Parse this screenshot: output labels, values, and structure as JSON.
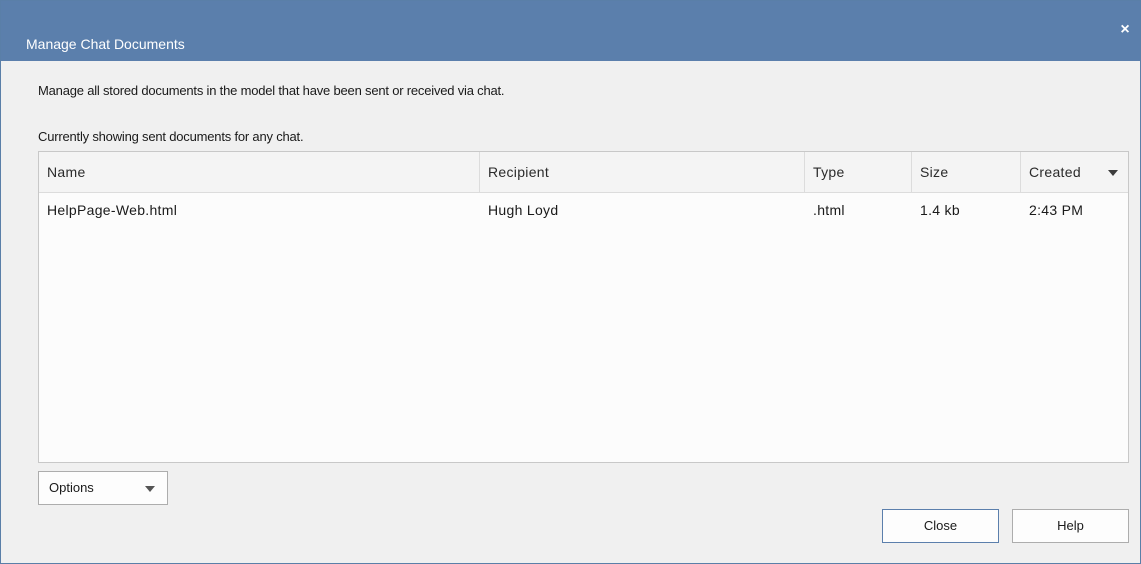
{
  "window": {
    "title": "Manage Chat Documents",
    "close_glyph": "×"
  },
  "description": "Manage all stored documents in the model that have been sent or received via chat.",
  "status_text": "Currently showing sent documents for any chat.",
  "table": {
    "columns": [
      "Name",
      "Recipient",
      "Type",
      "Size",
      "Created"
    ],
    "sorted_column": "Created",
    "rows": [
      {
        "name": "HelpPage-Web.html",
        "recipient": "Hugh Loyd",
        "type": ".html",
        "size": "1.4 kb",
        "created": "2:43 PM"
      }
    ]
  },
  "options_button": {
    "label": "Options"
  },
  "buttons": {
    "close": "Close",
    "help": "Help"
  },
  "colors": {
    "titlebar": "#5b7fac",
    "dialog_bg": "#f0f0f0",
    "list_bg": "#fcfcfc"
  },
  "icons": {
    "close": "close-icon",
    "sort": "sort-descending-icon",
    "dropdown": "chevron-down-icon"
  }
}
